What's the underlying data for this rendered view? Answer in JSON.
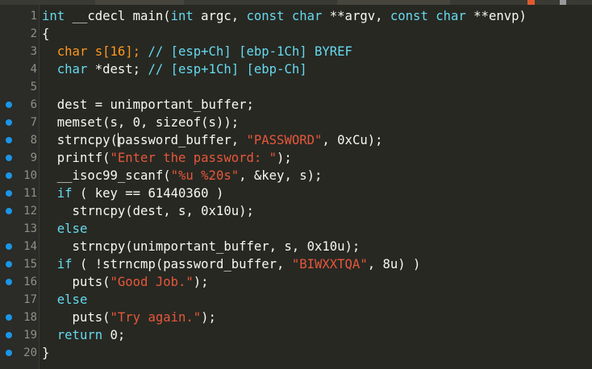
{
  "editor": {
    "breakpoint_color": "#1a96e8",
    "lines": [
      {
        "num": "1",
        "bp": false,
        "segs": [
          {
            "c": "ty",
            "t": "int"
          },
          {
            "c": "nm",
            "t": " __cdecl main("
          },
          {
            "c": "ty",
            "t": "int"
          },
          {
            "c": "nm",
            "t": " argc, "
          },
          {
            "c": "ty",
            "t": "const char"
          },
          {
            "c": "nm",
            "t": " **argv, "
          },
          {
            "c": "ty",
            "t": "const char"
          },
          {
            "c": "nm",
            "t": " **envp)"
          }
        ]
      },
      {
        "num": "2",
        "bp": false,
        "segs": [
          {
            "c": "nm",
            "t": "{"
          }
        ]
      },
      {
        "num": "3",
        "bp": false,
        "segs": [
          {
            "c": "ty2",
            "t": "  char s[16]; "
          },
          {
            "c": "cm",
            "t": "// [esp+Ch] [ebp-1Ch] BYREF"
          }
        ]
      },
      {
        "num": "4",
        "bp": false,
        "segs": [
          {
            "c": "ty",
            "t": "  char"
          },
          {
            "c": "nm",
            "t": " *dest; "
          },
          {
            "c": "cm",
            "t": "// [esp+1Ch] [ebp-Ch]"
          }
        ]
      },
      {
        "num": "5",
        "bp": false,
        "segs": [
          {
            "c": "nm",
            "t": ""
          }
        ]
      },
      {
        "num": "6",
        "bp": true,
        "segs": [
          {
            "c": "nm",
            "t": "  dest = unimportant_buffer;"
          }
        ]
      },
      {
        "num": "7",
        "bp": true,
        "segs": [
          {
            "c": "nm",
            "t": "  memset(s, 0, sizeof(s));"
          }
        ]
      },
      {
        "num": "8",
        "bp": true,
        "caret": true,
        "segs": [
          {
            "c": "nm",
            "t": "  strncpy("
          },
          {
            "c": "caret",
            "t": ""
          },
          {
            "c": "nm",
            "t": "password_buffer, "
          },
          {
            "c": "st",
            "t": "\"PASSWORD\""
          },
          {
            "c": "nm",
            "t": ", 0xCu);"
          }
        ]
      },
      {
        "num": "9",
        "bp": true,
        "segs": [
          {
            "c": "nm",
            "t": "  printf("
          },
          {
            "c": "st",
            "t": "\"Enter the password: \""
          },
          {
            "c": "nm",
            "t": ");"
          }
        ]
      },
      {
        "num": "10",
        "bp": true,
        "segs": [
          {
            "c": "nm",
            "t": "  __isoc99_scanf("
          },
          {
            "c": "st",
            "t": "\"%u %20s\""
          },
          {
            "c": "nm",
            "t": ", &key, s);"
          }
        ]
      },
      {
        "num": "11",
        "bp": true,
        "segs": [
          {
            "c": "kw",
            "t": "  if"
          },
          {
            "c": "nm",
            "t": " ( key == 61440360 )"
          }
        ]
      },
      {
        "num": "12",
        "bp": true,
        "segs": [
          {
            "c": "nm",
            "t": "    strncpy(dest, s, 0x10u);"
          }
        ]
      },
      {
        "num": "13",
        "bp": false,
        "segs": [
          {
            "c": "kw",
            "t": "  else"
          }
        ]
      },
      {
        "num": "14",
        "bp": true,
        "segs": [
          {
            "c": "nm",
            "t": "    strncpy(unimportant_buffer, s, 0x10u);"
          }
        ]
      },
      {
        "num": "15",
        "bp": true,
        "segs": [
          {
            "c": "kw",
            "t": "  if"
          },
          {
            "c": "nm",
            "t": " ( !strncmp(password_buffer, "
          },
          {
            "c": "st",
            "t": "\"BIWXXTQA\""
          },
          {
            "c": "nm",
            "t": ", 8u) )"
          }
        ]
      },
      {
        "num": "16",
        "bp": true,
        "segs": [
          {
            "c": "nm",
            "t": "    puts("
          },
          {
            "c": "st",
            "t": "\"Good Job.\""
          },
          {
            "c": "nm",
            "t": ");"
          }
        ]
      },
      {
        "num": "17",
        "bp": false,
        "segs": [
          {
            "c": "kw",
            "t": "  else"
          }
        ]
      },
      {
        "num": "18",
        "bp": true,
        "segs": [
          {
            "c": "nm",
            "t": "    puts("
          },
          {
            "c": "st",
            "t": "\"Try again.\""
          },
          {
            "c": "nm",
            "t": ");"
          }
        ]
      },
      {
        "num": "19",
        "bp": true,
        "segs": [
          {
            "c": "kw",
            "t": "  return"
          },
          {
            "c": "nm",
            "t": " 0;"
          }
        ]
      },
      {
        "num": "20",
        "bp": true,
        "segs": [
          {
            "c": "nm",
            "t": "}"
          }
        ]
      }
    ]
  }
}
